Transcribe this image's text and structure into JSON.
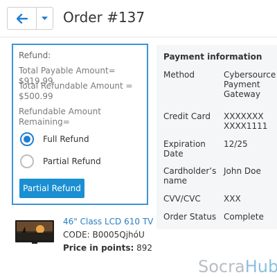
{
  "header": {
    "title": "Order #137"
  },
  "refund": {
    "title": "Refund:",
    "total_payable": "Total Payable Amount= $919.99",
    "total_refundable": "Total Refundable Amount = $500.99",
    "remaining": "Refundable Amount Remaining=",
    "options": [
      {
        "label": "Full Refund",
        "checked": true
      },
      {
        "label": "Partial Refund",
        "checked": false
      }
    ],
    "button_label": "Partial Refund"
  },
  "payment": {
    "heading": "Payment information",
    "rows": [
      {
        "label": "Method",
        "value": "Cybersource Payment Gateway"
      },
      {
        "label": "Credit Card",
        "value": "XXXXXXX XXXX1111"
      },
      {
        "label": "Expiration Date",
        "value": "12/25"
      },
      {
        "label": "Cardholder’s name",
        "value": "John Doe"
      },
      {
        "label": "CVV/CVC",
        "value": "XXX"
      },
      {
        "label": "Order Status",
        "value": "Complete"
      }
    ]
  },
  "product": {
    "name": "46\" Class LCD 610 TV",
    "code": "CODE: B0005QjhóU",
    "points_label": "Price in points:",
    "points_value": "892"
  },
  "watermark": {
    "part1": "Socra",
    "part2": "Hub"
  },
  "colors": {
    "accent": "#1a8fd1",
    "panel_border": "#3a94d8",
    "link": "#2a7dc2",
    "payment_bg": "#f4f6f8"
  }
}
